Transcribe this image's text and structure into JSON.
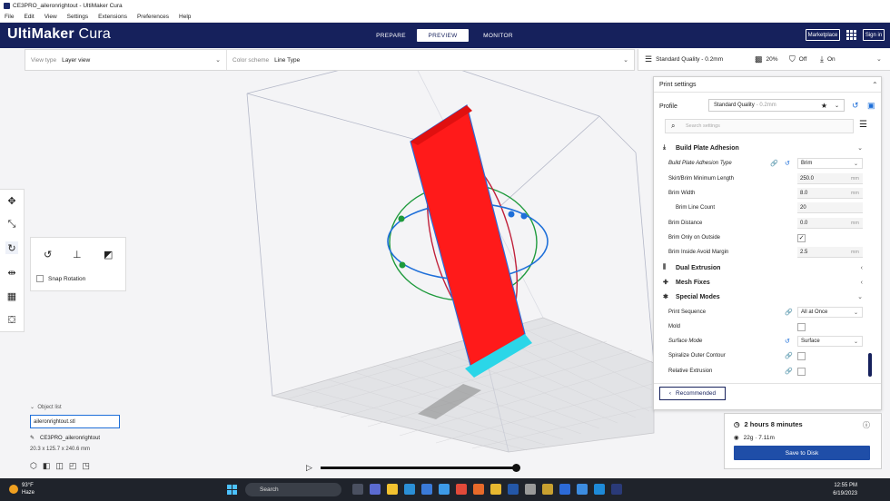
{
  "window": {
    "title": "CE3PRO_aileronrightout - UltiMaker Cura"
  },
  "menu": [
    "File",
    "Edit",
    "View",
    "Settings",
    "Extensions",
    "Preferences",
    "Help"
  ],
  "header": {
    "brand_bold": "UltiMaker",
    "brand_light": " Cura",
    "tabs": [
      "PREPARE",
      "PREVIEW",
      "MONITOR"
    ],
    "active_tab": "PREVIEW",
    "marketplace": "Marketplace",
    "signin": "Sign in"
  },
  "toolbar": {
    "view_type_label": "View type",
    "view_type_value": "Layer view",
    "color_scheme_label": "Color scheme",
    "color_scheme_value": "Line Type"
  },
  "quality_bar": {
    "profile": "Standard Quality - 0.2mm",
    "infill": "20%",
    "support": "Off",
    "adhesion": "On"
  },
  "rotate_panel": {
    "snap_label": "Snap Rotation",
    "snap_checked": false
  },
  "object": {
    "list_label": "Object list",
    "filename": "aileronrightout.stl",
    "name": "CE3PRO_aileronrightout",
    "dimensions": "20.3 x 125.7 x 240.6 mm"
  },
  "print_settings": {
    "title": "Print settings",
    "profile_label": "Profile",
    "profile_value": "Standard Quality",
    "profile_sub": "- 0.2mm",
    "search_placeholder": "Search settings",
    "categories": {
      "adhesion": "Build Plate Adhesion",
      "dual": "Dual Extrusion",
      "mesh": "Mesh Fixes",
      "special": "Special Modes"
    },
    "settings": {
      "adhesion_type": {
        "label": "Build Plate Adhesion Type",
        "value": "Brim"
      },
      "skirt_min": {
        "label": "Skirt/Brim Minimum Length",
        "value": "250.0",
        "unit": "mm"
      },
      "brim_width": {
        "label": "Brim Width",
        "value": "8.0",
        "unit": "mm"
      },
      "brim_lines": {
        "label": "Brim Line Count",
        "value": "20"
      },
      "brim_distance": {
        "label": "Brim Distance",
        "value": "0.0",
        "unit": "mm"
      },
      "brim_outside": {
        "label": "Brim Only on Outside",
        "checked": true
      },
      "brim_margin": {
        "label": "Brim Inside Avoid Margin",
        "value": "2.5",
        "unit": "mm"
      },
      "print_sequence": {
        "label": "Print Sequence",
        "value": "All at Once"
      },
      "mold": {
        "label": "Mold",
        "checked": false
      },
      "surface_mode": {
        "label": "Surface Mode",
        "value": "Surface"
      },
      "spiralize": {
        "label": "Spiralize Outer Contour",
        "checked": false
      },
      "relative": {
        "label": "Relative Extrusion",
        "checked": false
      }
    },
    "recommended_label": "Recommended"
  },
  "estimate": {
    "time": "2 hours 8 minutes",
    "material": "22g · 7.11m",
    "save_label": "Save to Disk"
  },
  "taskbar": {
    "temp": "93°F",
    "weather": "Haze",
    "search": "Search",
    "time": "12:55 PM",
    "date": "6/19/2023"
  },
  "colors": {
    "header": "#16215c",
    "model_red": "#ff1a1a",
    "accent_blue": "#1f4ea8",
    "rotate_green": "#1e9a3c",
    "rotate_red": "#c0203a",
    "rotate_blue": "#1e6fd9"
  }
}
